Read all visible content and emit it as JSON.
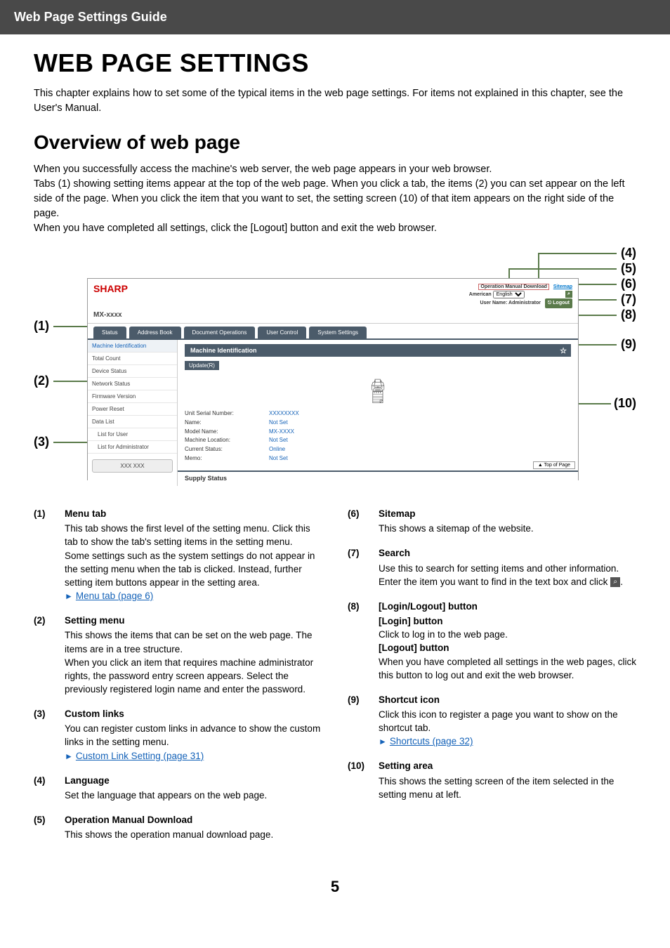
{
  "header": {
    "title": "Web Page Settings Guide"
  },
  "page": {
    "title": "WEB PAGE SETTINGS",
    "intro": "This chapter explains how to set some of the typical items in the web page settings. For items not explained in this chapter, see the User's Manual.",
    "section_title": "Overview of web page",
    "overview_p1": "When you successfully access the machine's web server, the web page appears in your web browser.",
    "overview_p2": "Tabs (1) showing setting items appear at the top of the web page. When you click a tab, the items (2) you can set appear on the left side of the page. When you click the item that you want to set, the setting screen (10) of that item appears on the right side of the page.",
    "overview_p3": "When you have completed all settings, click the [Logout] button and exit the web browser.",
    "page_number": "5"
  },
  "callouts": {
    "n1": "(1)",
    "n2": "(2)",
    "n3": "(3)",
    "n4": "(4)",
    "n5": "(5)",
    "n6": "(6)",
    "n7": "(7)",
    "n8": "(8)",
    "n9": "(9)",
    "n10": "(10)"
  },
  "screenshot": {
    "brand": "SHARP",
    "model": "MX-xxxx",
    "download_label": "Operation Manual Download",
    "sitemap_label": "Sitemap",
    "lang_prefix": "American",
    "lang_value": "English",
    "userline_prefix": "User Name: ",
    "userline_value": "Administrator",
    "logout": "Logout",
    "tabs": [
      "Status",
      "Address Book",
      "Document Operations",
      "User Control",
      "System Settings"
    ],
    "side": {
      "i0": "Machine Identification",
      "i1": "Total Count",
      "i2": "Device Status",
      "i3": "Network Status",
      "i4": "Firmware Version",
      "i5": "Power Reset",
      "i6": "Data List",
      "i7": "List for User",
      "i8": "List for Administrator",
      "custom": "XXX XXX"
    },
    "main": {
      "head": "Machine Identification",
      "update": "Update(R)",
      "labels": {
        "l0": "Unit Serial Number:",
        "l1": "Name:",
        "l2": "Model Name:",
        "l3": "Machine Location:",
        "l4": "Current Status:",
        "l5": "Memo:"
      },
      "values": {
        "v0": "XXXXXXXX",
        "v1": "Not Set",
        "v2": "MX-XXXX",
        "v3": "Not Set",
        "v4": "Online",
        "v5": "Not Set"
      },
      "supply": "Supply Status",
      "top_of_page": "Top of Page"
    }
  },
  "descriptions": {
    "d1": {
      "n": "(1)",
      "t": "Menu tab",
      "b1": "This tab shows the first level of the setting menu. Click this tab to show the tab's setting items in the setting menu.",
      "b2": "Some settings such as the system settings do not appear in the setting menu when the tab is clicked. Instead, further setting item buttons appear in the setting area.",
      "link": "Menu tab (page 6)"
    },
    "d2": {
      "n": "(2)",
      "t": "Setting menu",
      "b1": "This shows the items that can be set on the web page. The items are in a tree structure.",
      "b2": "When you click an item that requires machine administrator rights, the password entry screen appears. Select the previously registered login name and enter the password."
    },
    "d3": {
      "n": "(3)",
      "t": "Custom links",
      "b1": "You can register custom links in advance to show the custom links in the setting menu.",
      "link": "Custom Link Setting (page 31)"
    },
    "d4": {
      "n": "(4)",
      "t": "Language",
      "b1": "Set the language that appears on the web page."
    },
    "d5": {
      "n": "(5)",
      "t": "Operation Manual Download",
      "b1": "This shows the operation manual download page."
    },
    "d6": {
      "n": "(6)",
      "t": "Sitemap",
      "b1": "This shows a sitemap of the website."
    },
    "d7": {
      "n": "(7)",
      "t": "Search",
      "b1": "Use this to search for setting items and other information. Enter the item you want to find in the text box and click ",
      "b1_tail": "."
    },
    "d8": {
      "n": "(8)",
      "t": "[Login/Logout] button",
      "login_t": "[Login] button",
      "login_b": "Click to log in to the web page.",
      "logout_t": "[Logout] button",
      "logout_b": "When you have completed all settings in the web pages, click this button to log out and exit the web browser."
    },
    "d9": {
      "n": "(9)",
      "t": "Shortcut icon",
      "b1": "Click this icon to register a page you want to show on the shortcut tab.",
      "link": "Shortcuts (page 32)"
    },
    "d10": {
      "n": "(10)",
      "t": "Setting area",
      "b1": "This shows the setting screen of the item selected in the setting menu at left."
    }
  }
}
